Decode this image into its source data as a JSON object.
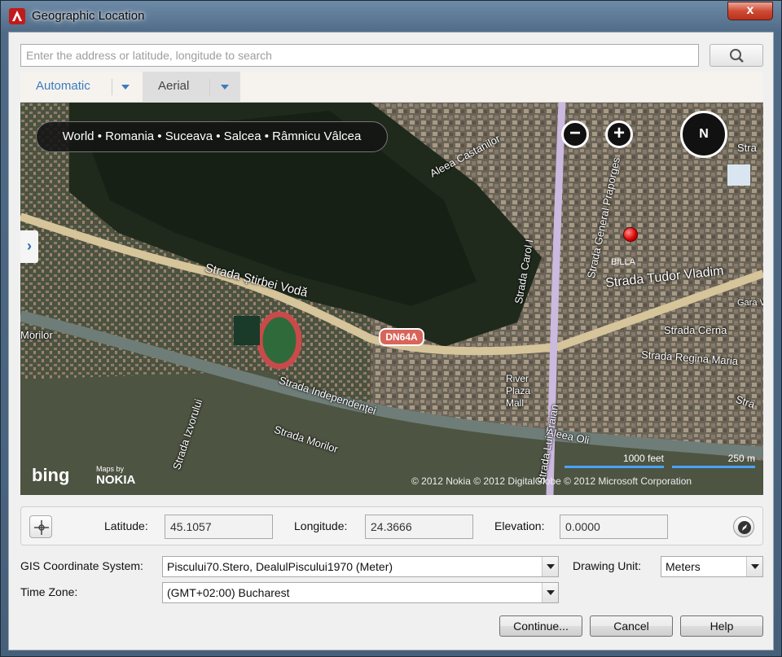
{
  "window": {
    "title": "Geographic Location",
    "close_symbol": "x",
    "app_icon": "autocad-icon"
  },
  "search": {
    "placeholder": "Enter the address or latitude, longitude to search",
    "value": "",
    "button_icon": "search-icon"
  },
  "map_tabs": [
    {
      "label": "Automatic",
      "selected": false
    },
    {
      "label": "Aerial",
      "selected": true
    }
  ],
  "map": {
    "breadcrumb": "World • Romania • Suceava • Salcea • Râmnicu Vâlcea",
    "zoom_out": "−",
    "zoom_in": "+",
    "compass": "N",
    "side_toggle": "›",
    "pin_label": "BILLA",
    "route_shield": "DN64A",
    "road_labels": [
      "Strada Știrbei Vodă",
      "Strada Tudor Vladim",
      "Aleea Castanilor",
      "Strada General Praporges",
      "Strada Carol I",
      "Strada Independenței",
      "Strada Morilor",
      "Strada Cerna",
      "Strada Regina Maria",
      "River Plaza Mall",
      "Morilor",
      "Strada Lui Traian",
      "Aleea Oli",
      "Strada Izvorului",
      "Gara Vâl",
      "Stra",
      "Stra"
    ],
    "brand_left": "bing",
    "brand_right_small": "Maps by",
    "brand_right": "NOKIA",
    "copyright": "© 2012 Nokia  © 2012 DigitalGlobe  © 2012 Microsoft Corporation",
    "scale_feet": "1000 feet",
    "scale_meters": "250 m"
  },
  "coordinates": {
    "latitude_label": "Latitude:",
    "latitude": "45.1057",
    "longitude_label": "Longitude:",
    "longitude": "24.3666",
    "elevation_label": "Elevation:",
    "elevation": "0.0000"
  },
  "settings": {
    "gis_label": "GIS Coordinate System:",
    "gis_value": "Piscului70.Stero, DealulPiscului1970 (Meter)",
    "drawing_unit_label": "Drawing Unit:",
    "drawing_unit_value": "Meters",
    "timezone_label": "Time Zone:",
    "timezone_value": "(GMT+02:00) Bucharest"
  },
  "buttons": {
    "continue": "Continue...",
    "cancel": "Cancel",
    "help": "Help"
  }
}
